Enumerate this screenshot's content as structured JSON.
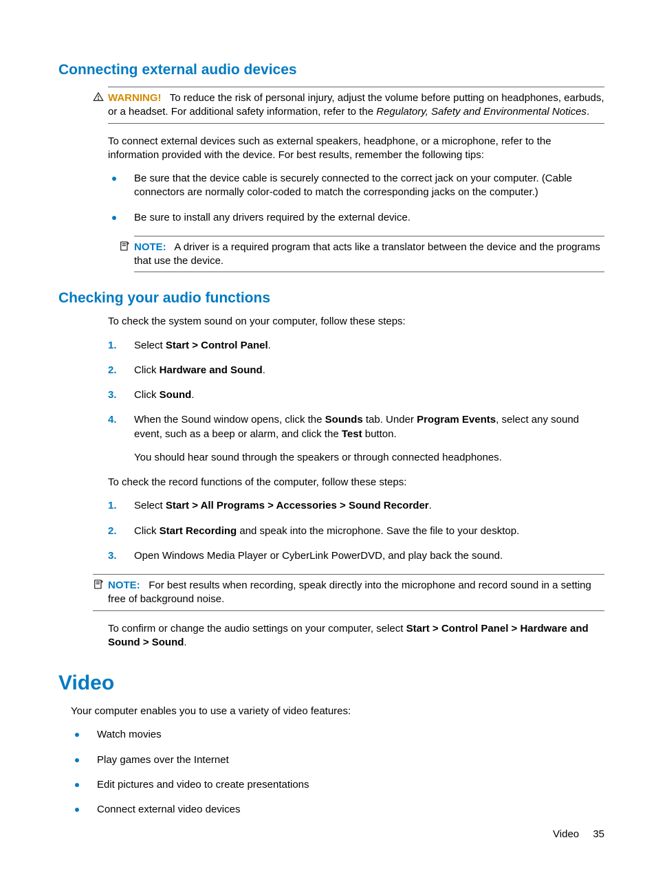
{
  "section1": {
    "heading": "Connecting external audio devices",
    "warning": {
      "label": "WARNING!",
      "text_before": "To reduce the risk of personal injury, adjust the volume before putting on headphones, earbuds, or a headset. For additional safety information, refer to the ",
      "italic": "Regulatory, Safety and Environmental Notices",
      "text_after": "."
    },
    "intro": "To connect external devices such as external speakers, headphone, or a microphone, refer to the information provided with the device. For best results, remember the following tips:",
    "bullets": [
      "Be sure that the device cable is securely connected to the correct jack on your computer. (Cable connectors are normally color-coded to match the corresponding jacks on the computer.)",
      "Be sure to install any drivers required by the external device."
    ],
    "note": {
      "label": "NOTE:",
      "text": "A driver is a required program that acts like a translator between the device and the programs that use the device."
    }
  },
  "section2": {
    "heading": "Checking your audio functions",
    "intro": "To check the system sound on your computer, follow these steps:",
    "steps_a": {
      "s1_a": "Select ",
      "s1_b": "Start > Control Panel",
      "s1_c": ".",
      "s2_a": "Click ",
      "s2_b": "Hardware and Sound",
      "s2_c": ".",
      "s3_a": "Click ",
      "s3_b": "Sound",
      "s3_c": ".",
      "s4_a": "When the Sound window opens, click the ",
      "s4_b": "Sounds",
      "s4_c": " tab. Under ",
      "s4_d": "Program Events",
      "s4_e": ", select any sound event, such as a beep or alarm, and click the ",
      "s4_f": "Test",
      "s4_g": " button.",
      "s4_sub": "You should hear sound through the speakers or through connected headphones."
    },
    "mid": "To check the record functions of the computer, follow these steps:",
    "steps_b": {
      "s1_a": "Select ",
      "s1_b": "Start > All Programs > Accessories > Sound Recorder",
      "s1_c": ".",
      "s2_a": "Click ",
      "s2_b": "Start Recording",
      "s2_c": " and speak into the microphone. Save the file to your desktop.",
      "s3": "Open Windows Media Player or CyberLink PowerDVD, and play back the sound."
    },
    "note2": {
      "label": "NOTE:",
      "text": "For best results when recording, speak directly into the microphone and record sound in a setting free of background noise."
    },
    "confirm_a": "To confirm or change the audio settings on your computer, select ",
    "confirm_b": "Start > Control Panel > Hardware and Sound > Sound",
    "confirm_c": "."
  },
  "section3": {
    "heading": "Video",
    "intro": "Your computer enables you to use a variety of video features:",
    "bullets": [
      "Watch movies",
      "Play games over the Internet",
      "Edit pictures and video to create presentations",
      "Connect external video devices"
    ]
  },
  "footer": {
    "section": "Video",
    "page": "35"
  }
}
